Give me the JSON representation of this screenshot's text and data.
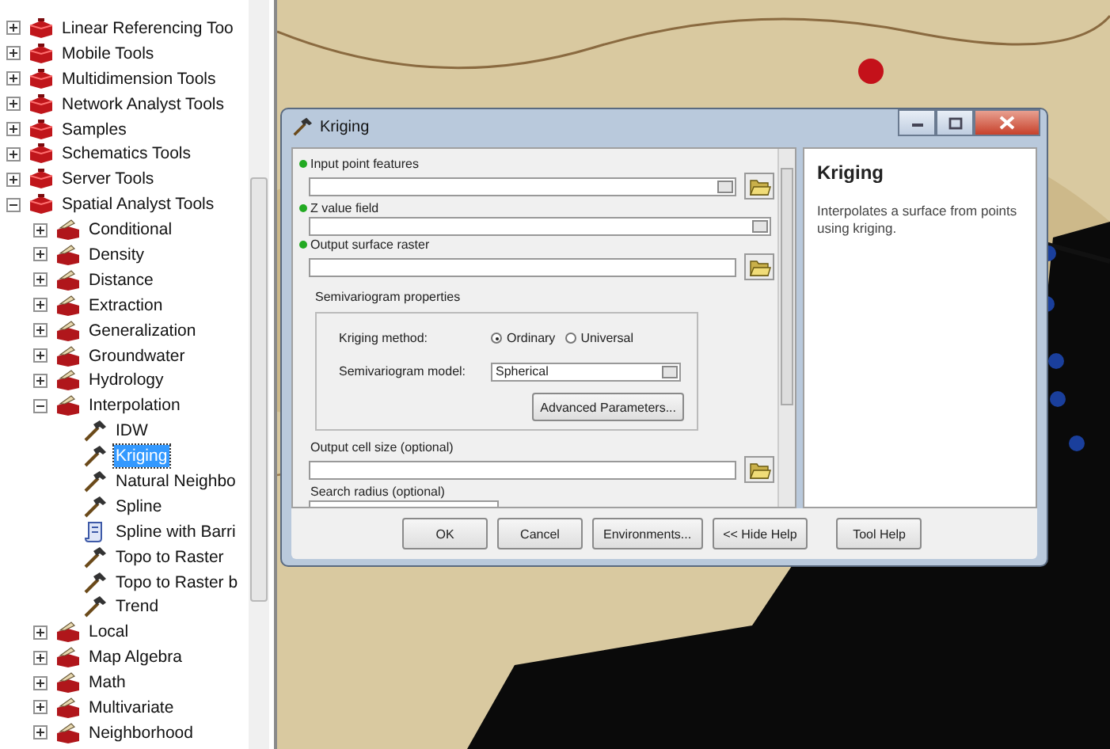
{
  "tree": [
    {
      "label": "Linear Referencing Too",
      "kind": "toolbox",
      "expanded": false
    },
    {
      "label": "Mobile Tools",
      "kind": "toolbox",
      "expanded": false
    },
    {
      "label": "Multidimension Tools",
      "kind": "toolbox",
      "expanded": false
    },
    {
      "label": "Network Analyst Tools",
      "kind": "toolbox",
      "expanded": false
    },
    {
      "label": "Samples",
      "kind": "toolbox",
      "expanded": false
    },
    {
      "label": "Schematics Tools",
      "kind": "toolbox",
      "expanded": false
    },
    {
      "label": "Server Tools",
      "kind": "toolbox",
      "expanded": false
    },
    {
      "label": "Spatial Analyst Tools",
      "kind": "toolbox",
      "expanded": true,
      "children": [
        {
          "label": "Conditional",
          "kind": "toolset",
          "expanded": false
        },
        {
          "label": "Density",
          "kind": "toolset",
          "expanded": false
        },
        {
          "label": "Distance",
          "kind": "toolset",
          "expanded": false
        },
        {
          "label": "Extraction",
          "kind": "toolset",
          "expanded": false
        },
        {
          "label": "Generalization",
          "kind": "toolset",
          "expanded": false
        },
        {
          "label": "Groundwater",
          "kind": "toolset",
          "expanded": false
        },
        {
          "label": "Hydrology",
          "kind": "toolset",
          "expanded": false
        },
        {
          "label": "Interpolation",
          "kind": "toolset",
          "expanded": true,
          "children": [
            {
              "label": "IDW",
              "kind": "tool",
              "selected": false
            },
            {
              "label": "Kriging",
              "kind": "tool",
              "selected": true
            },
            {
              "label": "Natural Neighbo",
              "kind": "tool",
              "selected": false
            },
            {
              "label": "Spline",
              "kind": "tool",
              "selected": false
            },
            {
              "label": "Spline with Barri",
              "kind": "script",
              "selected": false
            },
            {
              "label": "Topo to Raster",
              "kind": "tool",
              "selected": false
            },
            {
              "label": "Topo to Raster b",
              "kind": "tool",
              "selected": false
            },
            {
              "label": "Trend",
              "kind": "tool",
              "selected": false
            }
          ]
        },
        {
          "label": "Local",
          "kind": "toolset",
          "expanded": false
        },
        {
          "label": "Map Algebra",
          "kind": "toolset",
          "expanded": false
        },
        {
          "label": "Math",
          "kind": "toolset",
          "expanded": false
        },
        {
          "label": "Multivariate",
          "kind": "toolset",
          "expanded": false
        },
        {
          "label": "Neighborhood",
          "kind": "toolset",
          "expanded": false
        }
      ]
    }
  ],
  "dialog": {
    "title": "Kriging",
    "parameters": [
      {
        "label": "Input point features",
        "required": true,
        "kind": "combo-browse"
      },
      {
        "label": "Z value field",
        "required": true,
        "kind": "combo"
      },
      {
        "label": "Output surface raster",
        "required": true,
        "kind": "text-browse"
      }
    ],
    "semivariogram": {
      "heading": "Semivariogram properties",
      "method_label": "Kriging method:",
      "methods": [
        {
          "label": "Ordinary",
          "selected": true
        },
        {
          "label": "Universal",
          "selected": false
        }
      ],
      "model_label": "Semivariogram model:",
      "model_value": "Spherical",
      "advanced_button": "Advanced Parameters..."
    },
    "optional_parameters": [
      {
        "label": "Output cell size (optional)",
        "kind": "text-browse"
      },
      {
        "label": "Search radius (optional)",
        "kind": "partial"
      }
    ],
    "buttons": [
      "OK",
      "Cancel",
      "Environments...",
      "<< Hide Help",
      "Tool Help"
    ],
    "help": {
      "title": "Kriging",
      "text": "Interpolates a surface from points using kriging."
    }
  }
}
